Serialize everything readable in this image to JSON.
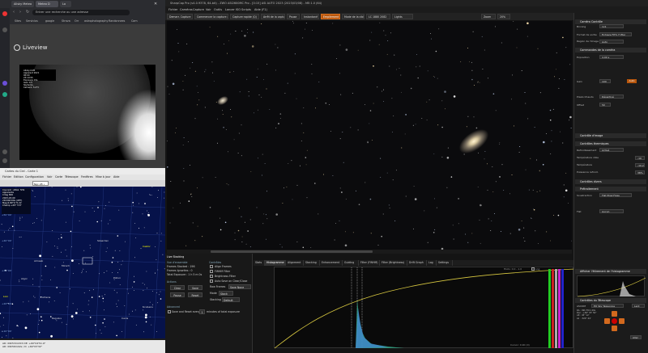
{
  "browser": {
    "tabs": [
      "Allsky Meteo",
      "Meteo D",
      "Lo"
    ],
    "url": "Entrer une recherche ou une adresse",
    "bookmarks": [
      "Sites",
      "Servicios",
      "google",
      "Strava",
      "Orr",
      "astrophotography",
      "Randonnees",
      "Cam"
    ],
    "liveview_title": "Liveview",
    "allsky_overlay": "Allsky-CAM\nApparent 2021\n00:00 \n23:10:55\nExposure 15s\nGain 0.5 \nSkytemp -\nCamera -5.4°C"
  },
  "planetarium": {
    "title": "Cartes du Ciel - Carte 1",
    "menu": [
      "Fichier",
      "Edition",
      "Configuration",
      "Voir",
      "Carte",
      "Télescope",
      "Fenêtres",
      "Mise à jour",
      "Aide"
    ],
    "field": "Ngc 28 •",
    "info": "Courant : AltAz  5H1\nApparente\nCrlag 800\n2023-03-09\n21h00m00s (UET)\nMag 6.80\"0.\"0.22\nChamp +05° 5'0\"",
    "labels": [
      {
        "text": "Mirach",
        "yellow": false
      },
      {
        "text": "Skaarden",
        "yellow": false
      },
      {
        "text": "Castor",
        "yellow": true
      },
      {
        "text": "Almaak",
        "yellow": false
      },
      {
        "text": "Algol",
        "yellow": false
      },
      {
        "text": "Pollux",
        "yellow": false
      },
      {
        "text": "Alhena",
        "yellow": false
      },
      {
        "text": "Regulus",
        "yellow": false
      },
      {
        "text": "Acubens",
        "yellow": false
      },
      {
        "text": "Canis",
        "yellow": false
      },
      {
        "text": "Lion",
        "yellow": true
      }
    ],
    "grid_labels": [
      "+50°00'",
      "+40°00'",
      "+30°00'",
      "+20°00'",
      "+10°00'"
    ],
    "status": "AD: 09h53m18.5 DE: +60°04'51.9\"\nAD: 09h56m42s / D: +69°03'32\""
  },
  "app": {
    "title": "SharpCap Pro (v4.0.9378, 64-bit) - ZWO ASI2600MC Pro - [0:15] ASI AUTO 2023 (2023/03/08) - ME:1.0 (64)",
    "menu": [
      "Fichier",
      "Caméras",
      "Capture",
      "Voir",
      "Outils",
      "Lancer ISO",
      "Scripts",
      "Aide (F1)"
    ],
    "toolbar": [
      {
        "label": "Demarr. Capture",
        "orange": false
      },
      {
        "label": "Commencer la capture (C)",
        "orange": false
      },
      {
        "label": "Capture rapide (Q)",
        "orange": false
      },
      {
        "label": "Arrêt de la capture",
        "orange": false
      },
      {
        "label": "Pause",
        "orange": false
      },
      {
        "label": "Instantané",
        "orange": false
      },
      {
        "label": "Empilement",
        "orange": true
      },
      {
        "label": "Mode de la cible",
        "orange": false
      },
      {
        "label": "LC 1880 2082",
        "orange": false
      },
      {
        "label": "Lights",
        "orange": false
      },
      {
        "label": "Zoom",
        "orange": false
      },
      {
        "label": "20%",
        "orange": false
      }
    ]
  },
  "livestack": {
    "title": "Live Stacking",
    "overview_label": "Vue d'ensemble",
    "frames_stacked": "Frames Stacked : 196",
    "frames_ignored": "Frames Ignorées : 0",
    "total_exposure": "Total Exposure : 1 h 5 m 0s",
    "actions_label": "Actions",
    "clear_button": "Clear",
    "save_button": "Save",
    "pause_button": "Pause",
    "reset_button": "Reset",
    "controls_label": "Contrôles",
    "align_frames": "Align Frames",
    "fwhm_filter": "FWHM Filter",
    "brightness_filter": "Brightness Filter",
    "auto_save": "Auto Save on Clear/Close",
    "raw_frames_label": "Raw Frames",
    "raw_frames_value": "Save None",
    "mode_label": "Mode",
    "mode_value": "Stack",
    "stacking_label": "Stacking",
    "stacking_value": "Default",
    "advanced_label": "Advanced",
    "save_individual": "Save and Reset every",
    "save_individual_value": "1",
    "minutes_suffix": "minutes of total exposure",
    "tabs": [
      "Stats",
      "Histogramme",
      "Alignment",
      "Stacking",
      "Enhancement",
      "Guiding",
      "Filter (FWHM)",
      "Filter (Brightness)",
      "Drift Graph",
      "Log",
      "Settings"
    ],
    "active_tab": 1,
    "histogram_readout": "Histo: 0.0 - 1.0",
    "histogram_log": "Log",
    "cursor_value": "Cursor: 0.90 (0)"
  },
  "right_panel": {
    "sections": [
      {
        "title": "Caméra Contrôle",
        "rows": [
          [
            "Binning",
            "1x1"
          ],
          [
            "Format de sortie",
            "Fichiers FITS (*.fits)"
          ],
          [
            "Region de l'image",
            "Auto"
          ]
        ]
      },
      {
        "title": "Commandes de la caméra",
        "rows": [
          [
            "Exposition",
            "4.00 s"
          ],
          [
            "Gain",
            "100"
          ],
          [
            "Pixels Chauds",
            "Désactivé"
          ],
          [
            "Offset",
            "50"
          ]
        ]
      },
      {
        "title": "Contrôle d'image",
        "rows": [
          [
            "Luminosité",
            "0.00"
          ],
          [
            "Balance",
            "Auto"
          ]
        ]
      },
      {
        "title": "Contrôles thermiques",
        "rows": [
          [
            "Refroidissement",
            "Activé"
          ],
          [
            "Température cible",
            "-10"
          ],
          [
            "Température",
            "-10.2"
          ],
          [
            "Puissance refroid.",
            "38%"
          ]
        ]
      },
      {
        "title": "Contrôles divers",
        "rows": []
      },
      {
        "title": "Prétraitement",
        "rows": [
          [
            "Soustraction",
            "Flat Pixel Fixes"
          ],
          [
            "Flat",
            "Aucun"
          ]
        ]
      },
      {
        "title": "Afficher l'étirement de l'histogramme",
        "rows": []
      },
      {
        "title": "Contrôles du Télescope",
        "rows": [
          [
            "ASCOM",
            "EQ Sky Telescope"
          ]
        ]
      }
    ],
    "telescope_rate": "Lent",
    "tele_coords": "RA : 09h 55m 40s\nDec : +69° 03' 50\"\nAlt : 45° 12'\nAz  : 320° 44'",
    "go_button": "Aller"
  },
  "colors": {
    "accent": "#b8560c",
    "bg": "#141414"
  }
}
